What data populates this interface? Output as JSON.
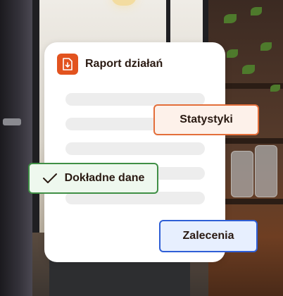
{
  "report": {
    "title": "Raport działań",
    "icon": "document-download-icon",
    "accent": "#e2531f"
  },
  "chips": {
    "statistics": {
      "label": "Statystyki",
      "border": "#e36e3a",
      "fill": "#fdf1ea"
    },
    "accurate_data": {
      "label": "Dokładne dane",
      "icon": "checkmark-icon",
      "border": "#3f8f45",
      "fill": "#eef8ee"
    },
    "recommendations": {
      "label": "Zalecenia",
      "border": "#2f5fd6",
      "fill": "#e7effe"
    }
  }
}
